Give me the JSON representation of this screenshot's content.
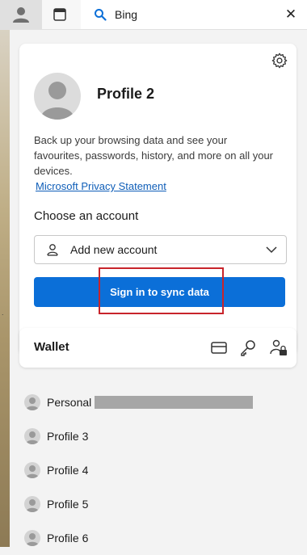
{
  "toolbar": {
    "tab_title": "Bing",
    "profile_icon": "person-icon",
    "tabs_icon": "vertical-tabs-icon",
    "search_icon": "search-icon",
    "close_icon": "close-icon"
  },
  "profile_card": {
    "name": "Profile 2",
    "description": "Back up your browsing data and see your favourites, passwords, history, and more on all your devices.",
    "privacy_link": "Microsoft Privacy Statement",
    "choose_label": "Choose an account",
    "account_select_value": "Add new account",
    "sync_button": "Sign in to sync data"
  },
  "wallet": {
    "label": "Wallet",
    "icons": [
      "credit-card-icon",
      "key-icon",
      "person-lock-icon"
    ]
  },
  "profiles": [
    {
      "name": "Personal",
      "redacted": true
    },
    {
      "name": "Profile 3"
    },
    {
      "name": "Profile 4"
    },
    {
      "name": "Profile 5"
    },
    {
      "name": "Profile 6"
    }
  ],
  "colors": {
    "accent": "#0b6fd8",
    "highlight": "#c8242b",
    "link": "#0f5eb8"
  }
}
